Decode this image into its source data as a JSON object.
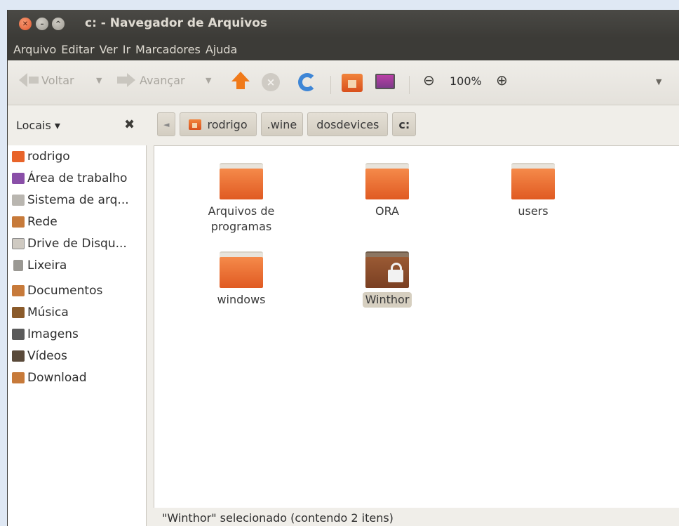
{
  "window": {
    "title": "c: - Navegador de Arquivos"
  },
  "menubar": {
    "items": [
      "Arquivo",
      "Editar",
      "Ver",
      "Ir",
      "Marcadores",
      "Ajuda"
    ]
  },
  "toolbar": {
    "back_label": "Voltar",
    "forward_label": "Avançar",
    "zoom_level": "100%",
    "icons": [
      "up-arrow-icon",
      "stop-icon",
      "reload-icon",
      "home-folder-icon",
      "computer-icon",
      "zoom-out-icon",
      "zoom-in-icon"
    ]
  },
  "sidebar": {
    "header_label": "Locais ▾",
    "close_glyph": "✖",
    "items": [
      {
        "label": "rodrigo",
        "icon": "home-folder-icon",
        "color": "#e8642a"
      },
      {
        "label": "Área de trabalho",
        "icon": "desktop-icon",
        "color": "#8a4fa8"
      },
      {
        "label": "Sistema de arq...",
        "icon": "filesystem-icon",
        "color": "#b9b6b0"
      },
      {
        "label": "Rede",
        "icon": "network-icon",
        "color": "#c77a3a"
      },
      {
        "label": "Drive de Disqu...",
        "icon": "floppy-drive-icon",
        "color": "#cfcac2"
      },
      {
        "label": "Lixeira",
        "icon": "trash-icon",
        "color": "#9a9893"
      },
      {
        "label": "Documentos",
        "icon": "documents-icon",
        "color": "#c77a3a"
      },
      {
        "label": "Música",
        "icon": "music-icon",
        "color": "#8a5a2a"
      },
      {
        "label": "Imagens",
        "icon": "pictures-icon",
        "color": "#5a5a5a"
      },
      {
        "label": "Vídeos",
        "icon": "videos-icon",
        "color": "#5a4a3a"
      },
      {
        "label": "Download",
        "icon": "download-icon",
        "color": "#c77a3a"
      }
    ]
  },
  "pathbar": {
    "back_glyph": "◄",
    "crumbs": [
      "rodrigo",
      ".wine",
      "dosdevices",
      "c:"
    ]
  },
  "files": [
    {
      "name_line1": "Arquivos de",
      "name_line2": "programas",
      "type": "folder"
    },
    {
      "name_line1": "ORA",
      "name_line2": "",
      "type": "folder"
    },
    {
      "name_line1": "users",
      "name_line2": "",
      "type": "folder"
    },
    {
      "name_line1": "windows",
      "name_line2": "",
      "type": "folder"
    },
    {
      "name_line1": "Winthor",
      "name_line2": "",
      "type": "locked-folder",
      "selected": true
    }
  ],
  "status": {
    "text": "\"Winthor\" selecionado (contendo 2 itens)"
  }
}
